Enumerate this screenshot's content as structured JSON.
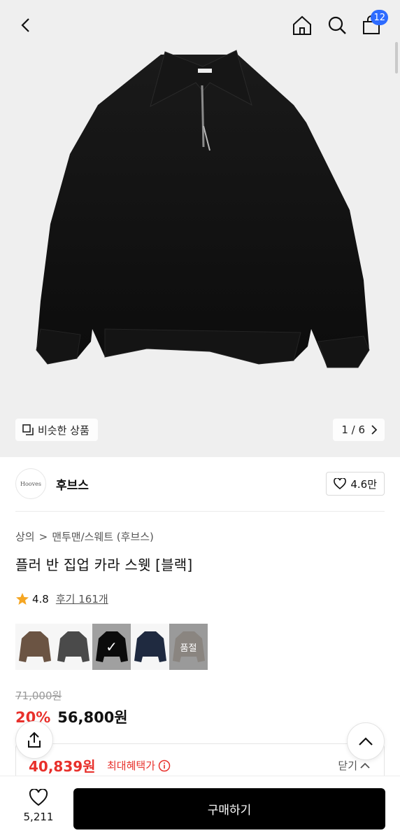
{
  "header": {
    "back_icon": "chevron-left-icon",
    "home_icon": "home-icon",
    "search_icon": "search-icon",
    "cart_icon": "shopping-bag-icon",
    "cart_count": "12"
  },
  "gallery": {
    "similar_label": "비슷한 상품",
    "page_current": "1",
    "page_sep": " / ",
    "page_total": "6"
  },
  "brand": {
    "logo_text": "Hooves",
    "name": "후브스",
    "likes": "4.6만"
  },
  "breadcrumb": {
    "category": "상의",
    "sep": ">",
    "subcategory": "맨투맨/스웨트 (후브스)"
  },
  "product": {
    "title": "플러 반 집업 카라 스웻 [블랙]",
    "rating": "4.8",
    "reviews": "후기 161개"
  },
  "swatches": [
    {
      "name": "brown",
      "color": "#6b5443",
      "selected": false,
      "soldout": false
    },
    {
      "name": "charcoal",
      "color": "#4a4a4a",
      "selected": false,
      "soldout": false
    },
    {
      "name": "black",
      "color": "#121212",
      "selected": true,
      "soldout": false
    },
    {
      "name": "navy",
      "color": "#1f2a40",
      "selected": false,
      "soldout": false
    },
    {
      "name": "gray",
      "color": "#8a8580",
      "selected": false,
      "soldout": true,
      "soldout_label": "품절"
    }
  ],
  "price": {
    "original": "71,000원",
    "discount": "20%",
    "sale": "56,800원"
  },
  "benefit": {
    "amount": "40,839원",
    "label": "최대혜택가",
    "close": "닫기"
  },
  "bottom": {
    "wish_count": "5,211",
    "buy_label": "구매하기"
  },
  "colors": {
    "accent_red": "#e8302b",
    "badge_blue": "#2d6bff"
  }
}
